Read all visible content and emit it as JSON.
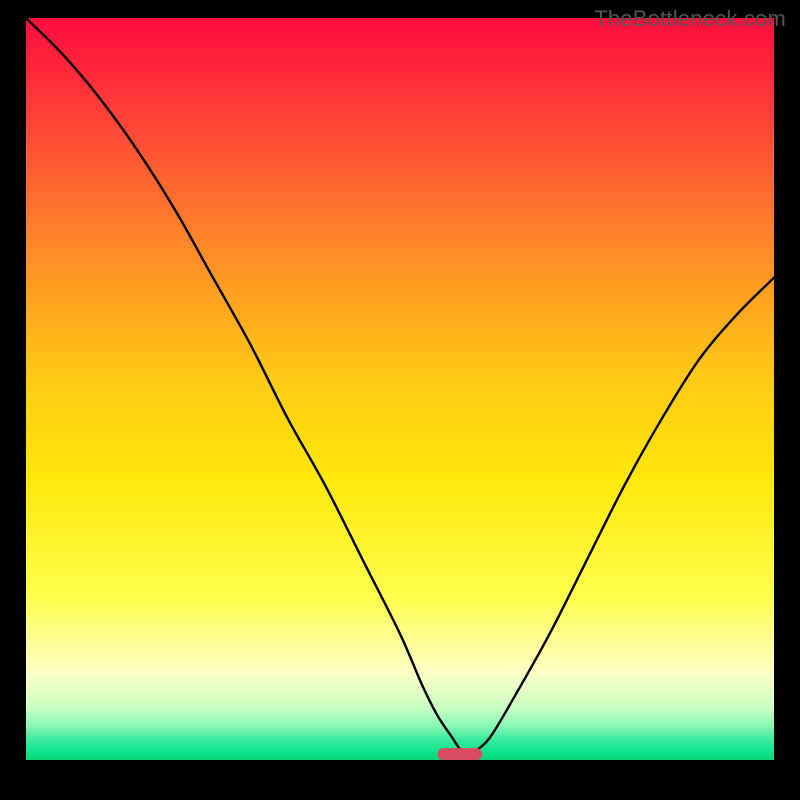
{
  "watermark": "TheBottleneck.com",
  "chart_data": {
    "type": "line",
    "title": "",
    "xlabel": "",
    "ylabel": "",
    "xlim": [
      0,
      100
    ],
    "ylim": [
      0,
      100
    ],
    "grid": false,
    "legend": false,
    "background_gradient_stops": [
      {
        "offset": 0.0,
        "color": "#ff0b3d"
      },
      {
        "offset": 0.14,
        "color": "#ff4438"
      },
      {
        "offset": 0.32,
        "color": "#ff8d26"
      },
      {
        "offset": 0.48,
        "color": "#ffc815"
      },
      {
        "offset": 0.62,
        "color": "#ffe70a"
      },
      {
        "offset": 0.78,
        "color": "#ffff4d"
      },
      {
        "offset": 0.88,
        "color": "#ffffc5"
      },
      {
        "offset": 0.93,
        "color": "#caffc4"
      },
      {
        "offset": 0.955,
        "color": "#86f8b4"
      },
      {
        "offset": 0.972,
        "color": "#3cea9e"
      },
      {
        "offset": 0.988,
        "color": "#0ee58c"
      },
      {
        "offset": 1.0,
        "color": "#0bd474"
      }
    ],
    "series": [
      {
        "name": "bottleneck-curve",
        "color": "#000000",
        "x": [
          0,
          5,
          10,
          15,
          20,
          25,
          30,
          35,
          40,
          45,
          50,
          53,
          55,
          57,
          58,
          59,
          60,
          62,
          65,
          70,
          75,
          80,
          85,
          90,
          95,
          100
        ],
        "y": [
          100,
          95,
          89,
          82,
          74,
          65,
          56,
          46,
          37,
          27,
          17,
          10,
          6,
          3,
          1.5,
          1,
          1.2,
          3,
          8,
          17,
          27,
          37,
          46,
          54,
          60,
          65
        ]
      }
    ],
    "markers": [
      {
        "name": "optimum-marker",
        "shape": "rounded-rect",
        "color": "#d94b63",
        "x_center": 58,
        "y_center": 0.8,
        "width_pct": 6,
        "height_pct": 1.6
      }
    ]
  }
}
